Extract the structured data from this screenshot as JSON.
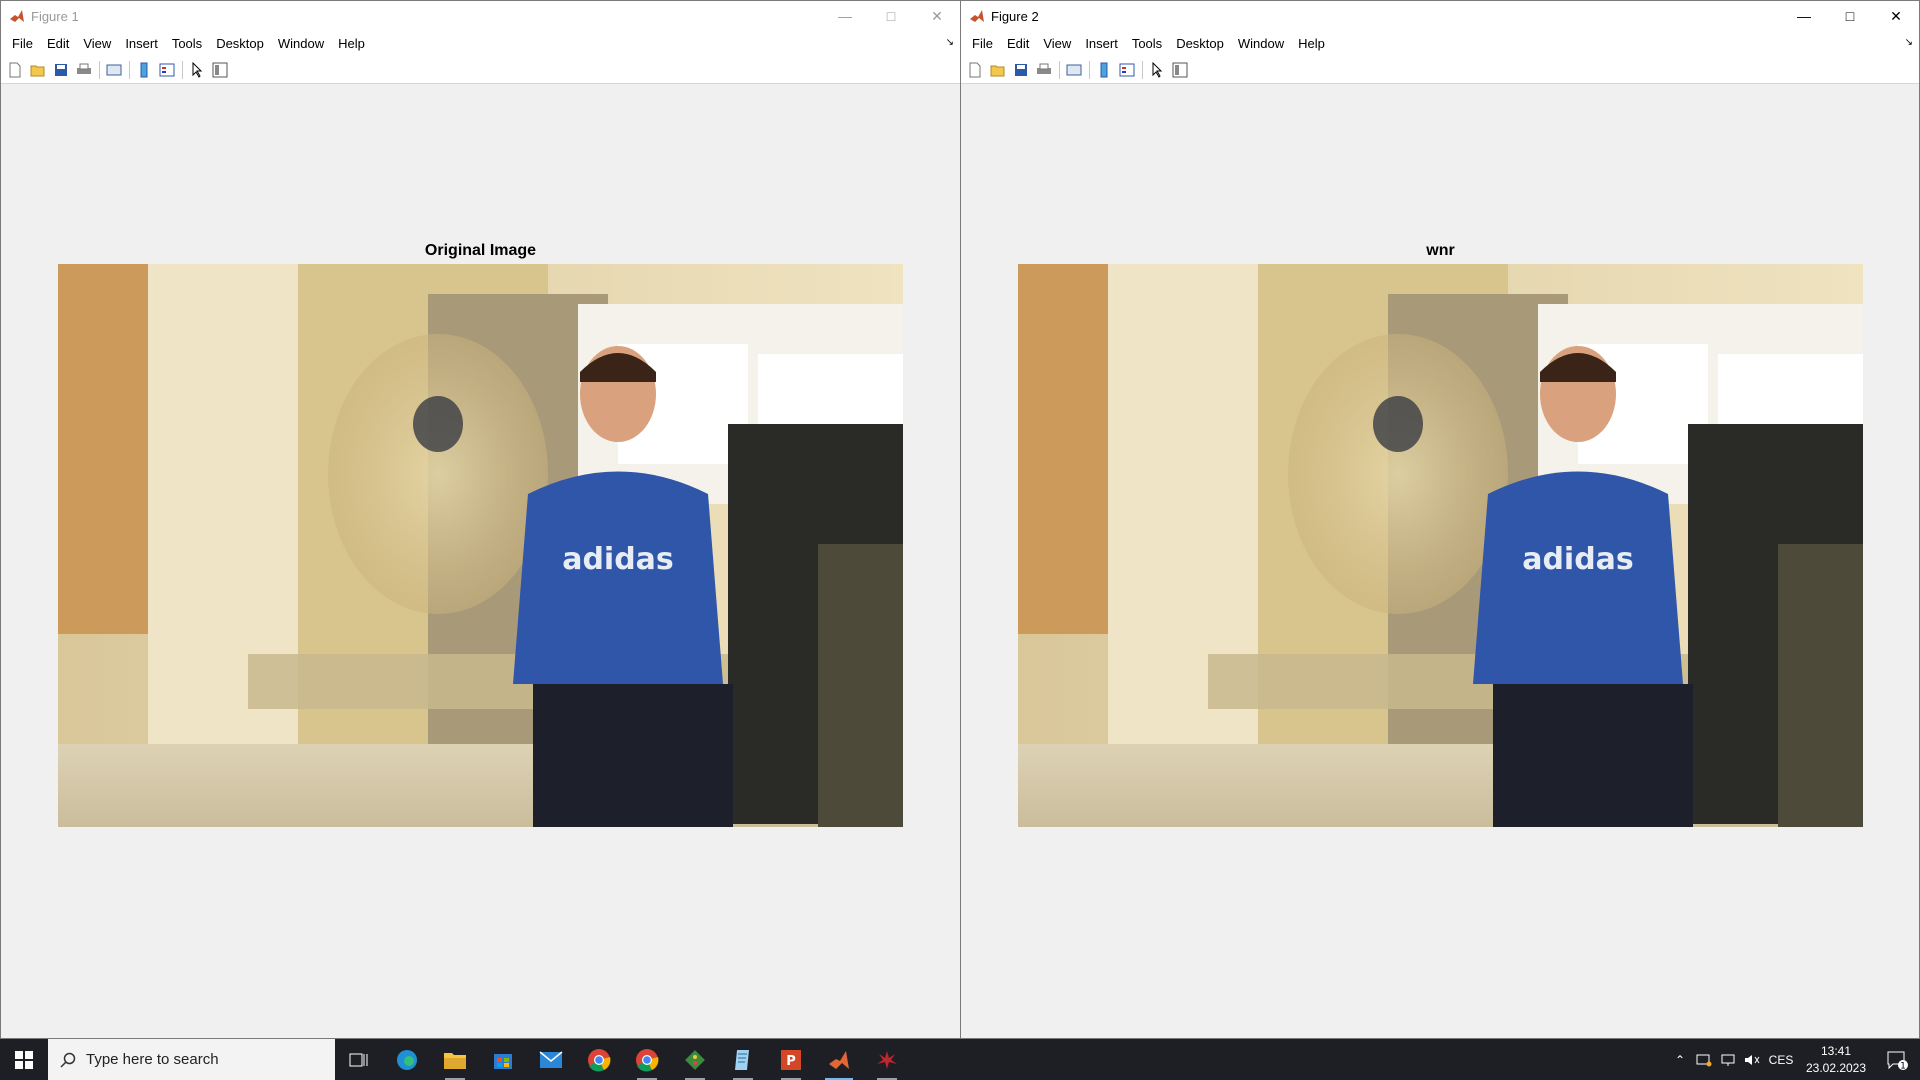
{
  "figures": [
    {
      "title": "Figure 1",
      "menu": [
        "File",
        "Edit",
        "View",
        "Insert",
        "Tools",
        "Desktop",
        "Window",
        "Help"
      ],
      "axes_title": "Original Image"
    },
    {
      "title": "Figure 2",
      "menu": [
        "File",
        "Edit",
        "View",
        "Insert",
        "Tools",
        "Desktop",
        "Window",
        "Help"
      ],
      "axes_title": "wnr"
    }
  ],
  "taskbar": {
    "search_placeholder": "Type here to search",
    "apps": [
      "task-view",
      "edge",
      "file-explorer",
      "microsoft-store",
      "mail",
      "chrome",
      "chrome",
      "git",
      "notepad",
      "powerpoint",
      "matlab",
      "matlab-figure"
    ],
    "tray": {
      "language": "CES",
      "time": "13:41",
      "date": "23.02.2023",
      "notification_count": "1"
    }
  },
  "colors": {
    "taskbar": "#1d1f25",
    "window_bg": "#f0f0f0",
    "shirt_blue": "#2f56a8",
    "wall_cream": "#e7d9b0"
  }
}
